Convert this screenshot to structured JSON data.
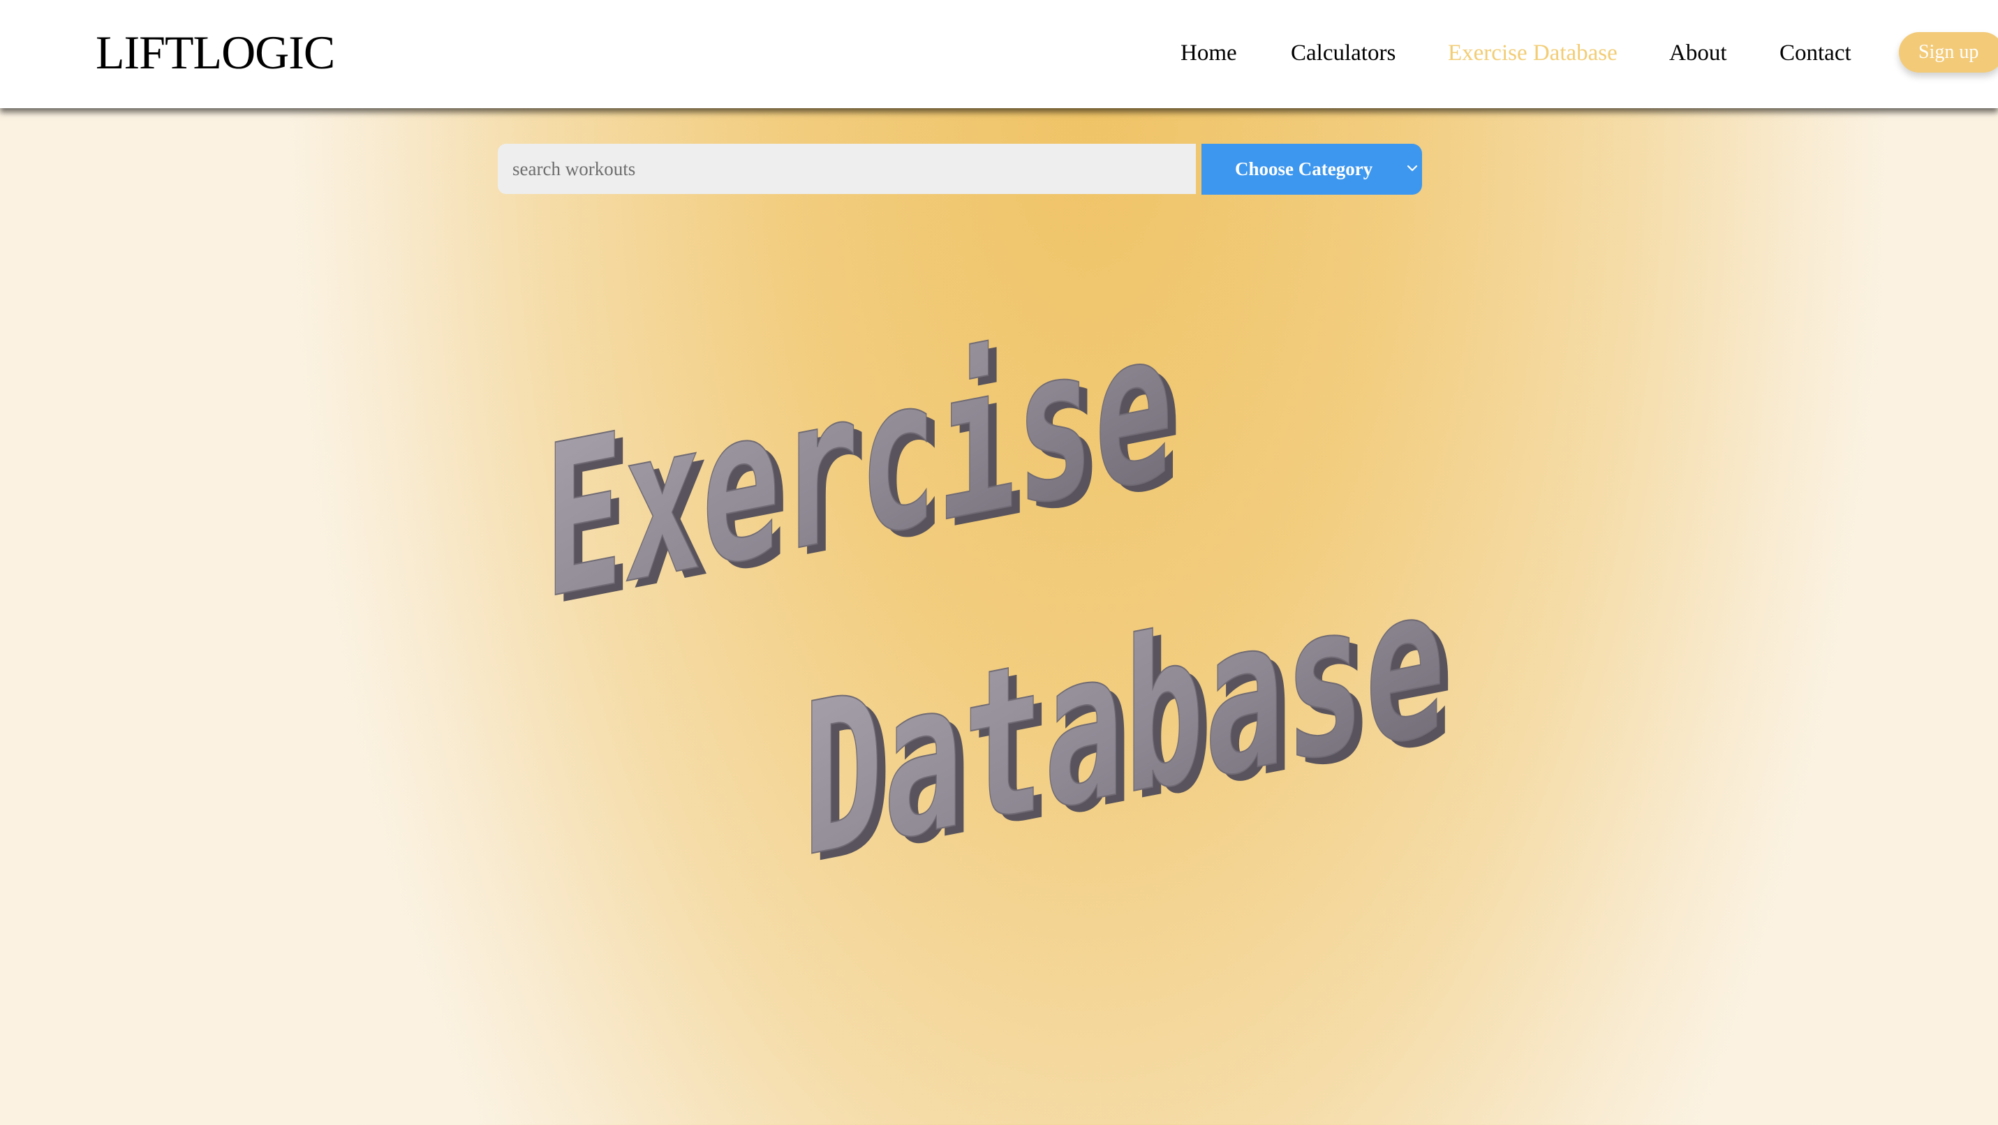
{
  "header": {
    "logo": "LIFTLOGIC",
    "nav": [
      {
        "label": "Home",
        "active": false
      },
      {
        "label": "Calculators",
        "active": false
      },
      {
        "label": "Exercise Database",
        "active": true
      },
      {
        "label": "About",
        "active": false
      },
      {
        "label": "Contact",
        "active": false
      }
    ],
    "signup_label": "Sign up"
  },
  "search": {
    "placeholder": "search workouts",
    "value": ""
  },
  "category_select": {
    "selected": "Choose Category",
    "icon": "chevron-down-icon"
  },
  "hero": {
    "line1": "Exercise",
    "line2": "Database"
  },
  "colors": {
    "accent": "#f2cd76",
    "button_blue": "#3d97ef",
    "background_center": "#efc366",
    "background_edge": "#fbf2e2",
    "hero_letter": "#8f8a94"
  }
}
